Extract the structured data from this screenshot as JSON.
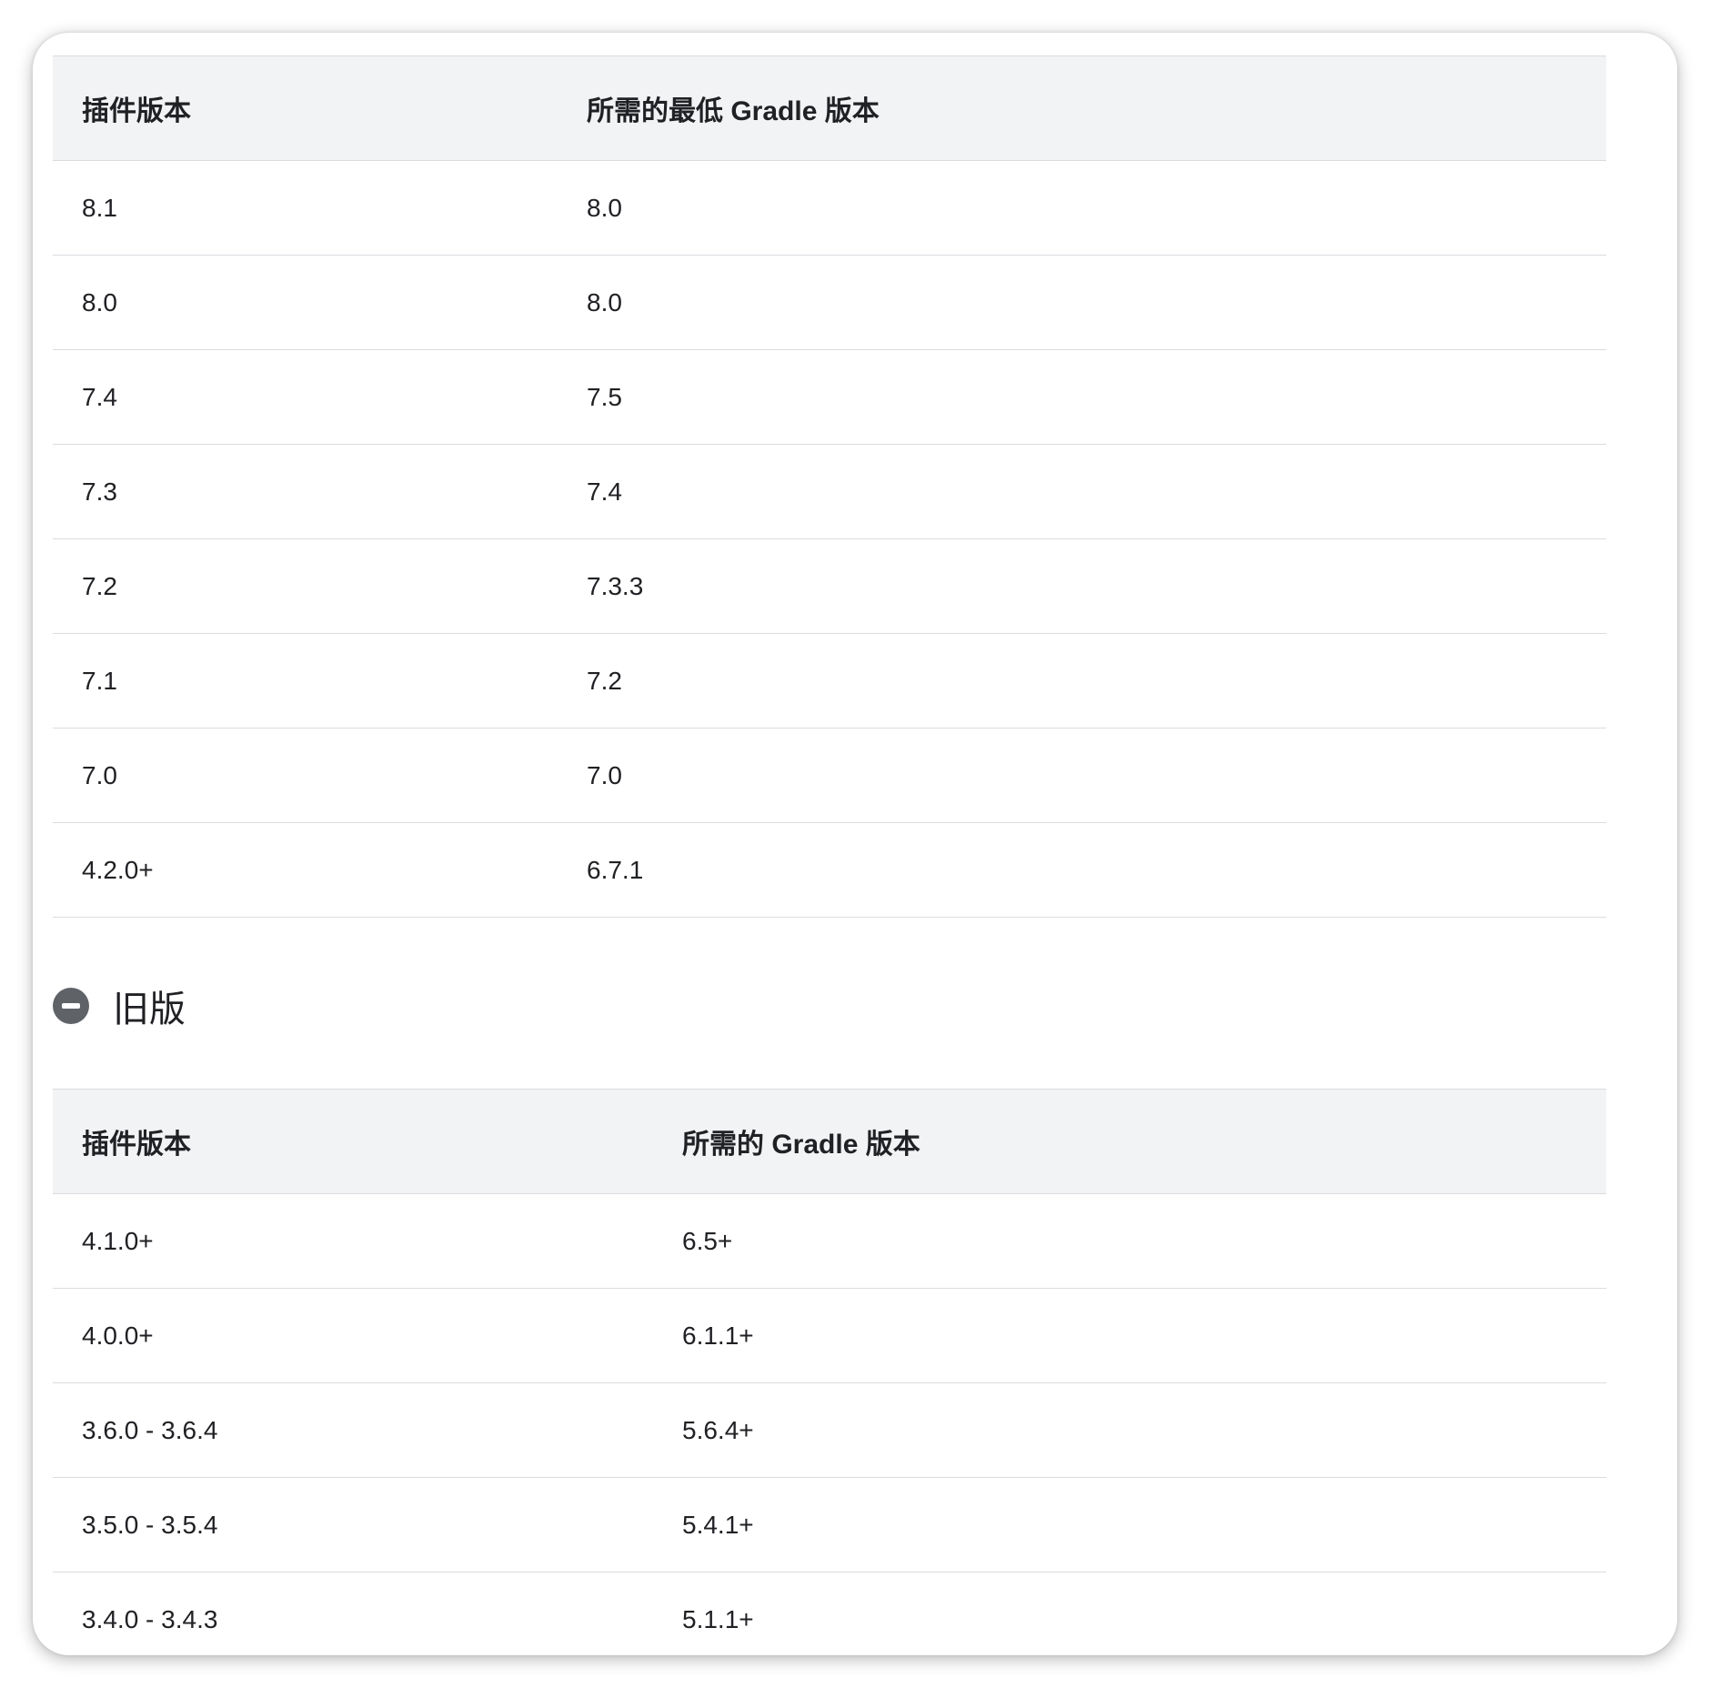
{
  "current_table": {
    "headers": [
      "插件版本",
      "所需的最低 Gradle 版本"
    ],
    "rows": [
      [
        "8.1",
        "8.0"
      ],
      [
        "8.0",
        "8.0"
      ],
      [
        "7.4",
        "7.5"
      ],
      [
        "7.3",
        "7.4"
      ],
      [
        "7.2",
        "7.3.3"
      ],
      [
        "7.1",
        "7.2"
      ],
      [
        "7.0",
        "7.0"
      ],
      [
        "4.2.0+",
        "6.7.1"
      ]
    ]
  },
  "legacy_section": {
    "title": "旧版",
    "icon": "collapse-minus-icon",
    "headers": [
      "插件版本",
      "所需的 Gradle 版本"
    ],
    "rows": [
      [
        "4.1.0+",
        "6.5+"
      ],
      [
        "4.0.0+",
        "6.1.1+"
      ],
      [
        "3.6.0 - 3.6.4",
        "5.6.4+"
      ],
      [
        "3.5.0 - 3.5.4",
        "5.4.1+"
      ],
      [
        "3.4.0 - 3.4.3",
        "5.1.1+"
      ]
    ]
  },
  "colors": {
    "header_bg": "#f1f3f4",
    "divider": "#dadce0",
    "icon": "#5f6368",
    "text": "#202124"
  }
}
